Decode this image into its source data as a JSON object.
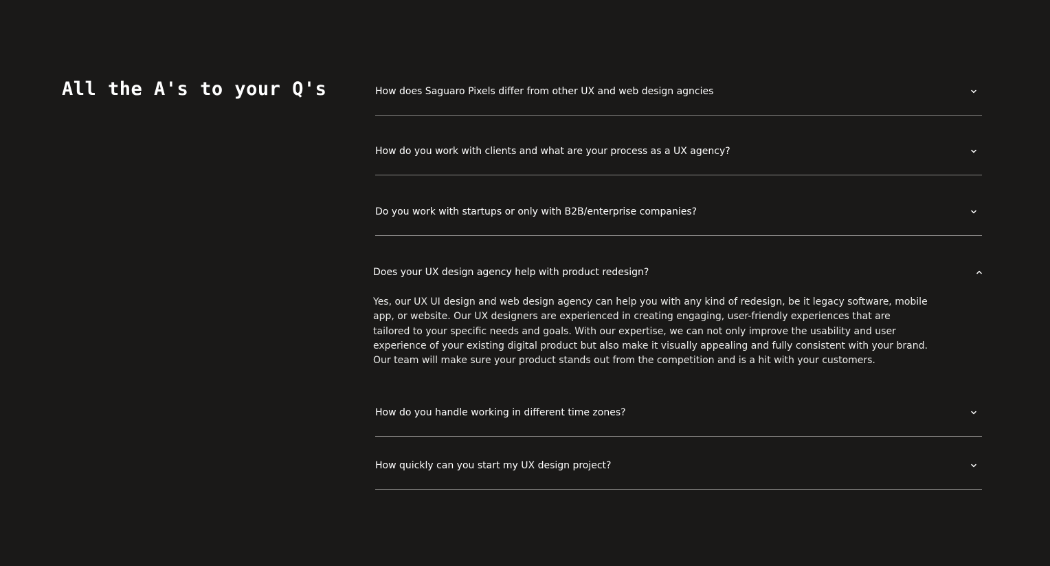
{
  "heading": "All the A's to your Q's",
  "faq": [
    {
      "question": "How does Saguaro Pixels differ from other UX and web design agncies",
      "expanded": false,
      "icon": "chevron-down-icon"
    },
    {
      "question": "How do you work with clients and what are your process as a UX agency?",
      "expanded": false,
      "icon": "chevron-down-icon"
    },
    {
      "question": "Do you work with startups or only with B2B/enterprise companies?",
      "expanded": false,
      "icon": "chevron-down-icon"
    },
    {
      "question": "Does your UX design agency help with product redesign?",
      "expanded": true,
      "icon": "chevron-up-icon",
      "answer": "Yes, our UX UI design and web design agency can help you with any kind of redesign, be it legacy software, mobile app, or website. Our UX designers are experienced in creating engaging, user-friendly experiences that are tailored to your specific needs and goals. With our expertise, we can not only improve the usability and user experience of your existing digital product but also make it visually appealing and fully consistent with your brand. Our team will make sure your product stands out from the competition and is a hit with your customers."
    },
    {
      "question": "How do you handle working in different time zones?",
      "expanded": false,
      "icon": "chevron-down-icon"
    },
    {
      "question": "How quickly can you start my UX design project?",
      "expanded": false,
      "icon": "chevron-down-icon"
    }
  ],
  "colors": {
    "background": "#1a1918",
    "text": "#ffffff",
    "divider": "#8a8886"
  }
}
